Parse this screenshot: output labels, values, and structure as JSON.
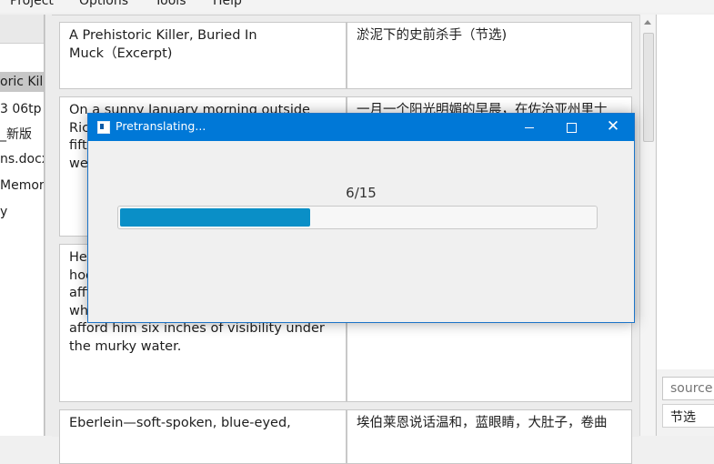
{
  "menu": [
    "Project",
    "Options",
    "Tools",
    "Help"
  ],
  "files": [
    "oric Kille",
    "3 06tp",
    "_新版",
    "ns.docx",
    "Memor",
    "y"
  ],
  "segments": [
    {
      "source": "A Prehistoric Killer, Buried In\nMuck（Excerpt)",
      "target": "淤泥下的史前杀手（节选)"
    },
    {
      "source": "On a sunny January morning outside\nRic\nfift\nwe",
      "target": "一月一个阳光明媚的早晨，在佐治亚州里士"
    },
    {
      "source": "He\nhoo\naffi\nwh\nafford him six inches of visibility under\nthe murky water.",
      "target": ""
    },
    {
      "source": "Eberlein—soft-spoken, blue-eyed,",
      "target": "埃伯莱恩说话温和，蓝眼睛，大肚子，卷曲"
    }
  ],
  "right_panel": {
    "search_placeholder": "source",
    "term": "节选"
  },
  "dialog": {
    "title": "Pretranslating...",
    "progress_text": "6/15",
    "progress_fraction": 0.4,
    "close_glyph": "✕"
  },
  "colors": {
    "titlebar": "#0078d7",
    "progress": "#0a8fc7"
  }
}
